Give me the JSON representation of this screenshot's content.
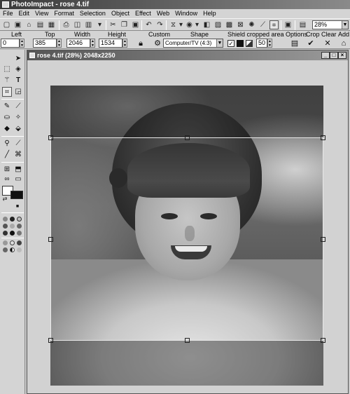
{
  "app": {
    "title": "PhotoImpact - rose 4.tif"
  },
  "menu": [
    "File",
    "Edit",
    "View",
    "Format",
    "Selection",
    "Object",
    "Effect",
    "Web",
    "Window",
    "Help"
  ],
  "toolbar": {
    "zoom": "28%"
  },
  "attributes": {
    "left_label": "Left",
    "left_value": "0",
    "top_label": "Top",
    "top_value": "385",
    "width_label": "Width",
    "width_value": "2046",
    "height_label": "Height",
    "height_value": "1534",
    "custom_label": "Custom",
    "shape_label": "Shape",
    "shape_value": "Computer/TV (4:3)",
    "shield_label": "Shield cropped area",
    "shield_opacity": "50",
    "options_label": "Options",
    "crop_label": "Crop",
    "clear_label": "Clear",
    "add_label": "Add"
  },
  "document": {
    "title": "rose 4.tif (28%) 2048x2250"
  },
  "colors": {
    "foreground": "#ffffff",
    "background": "#111111",
    "title_bar": "#3a3a3a"
  }
}
